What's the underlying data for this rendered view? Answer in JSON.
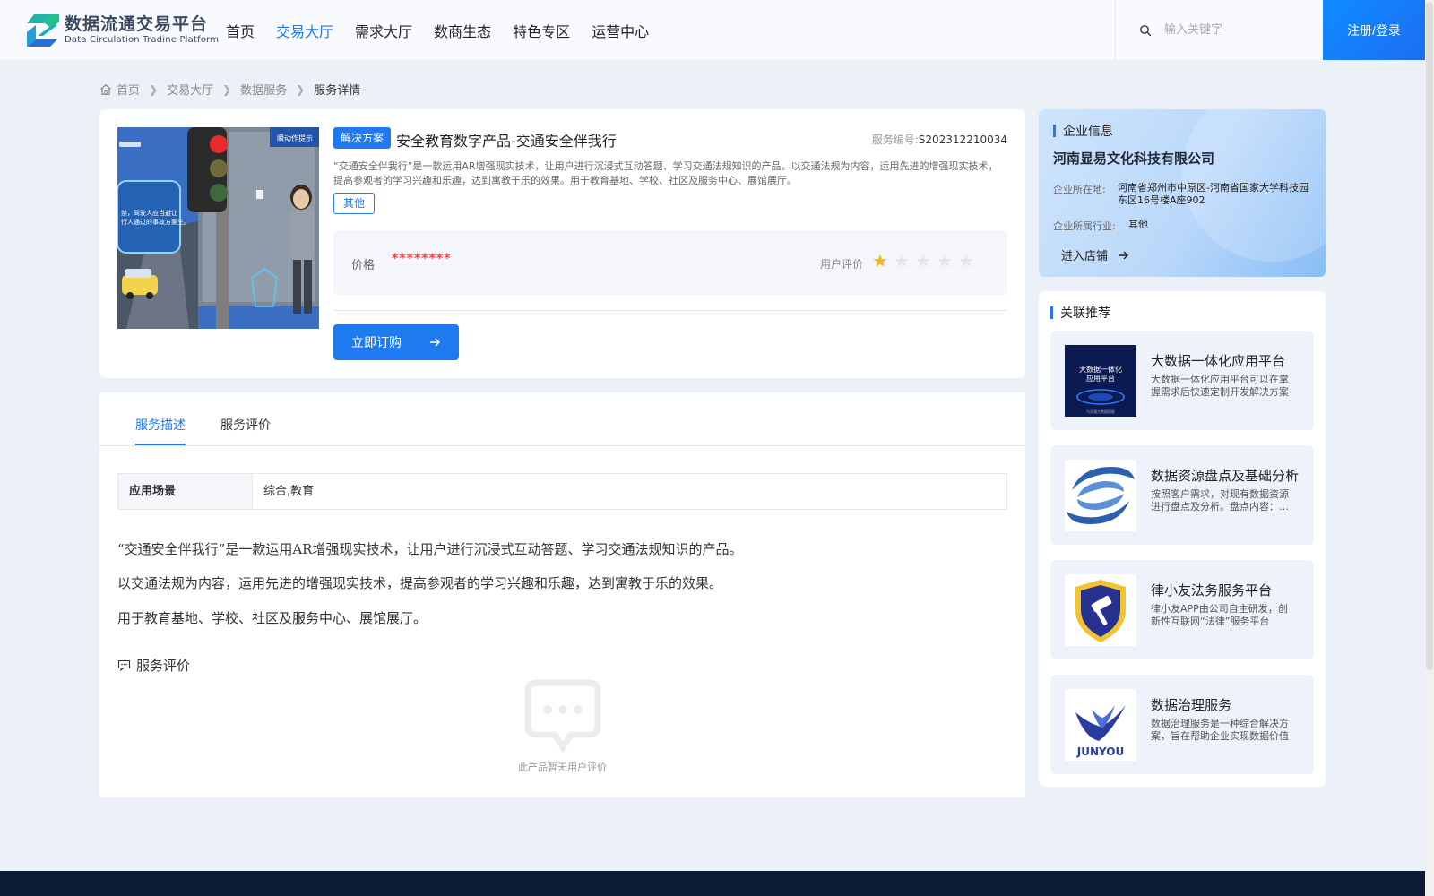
{
  "header": {
    "logo_cn": "数据流通交易平台",
    "logo_en": "Data Circulation Tradine Platform",
    "nav": [
      {
        "label": "首页",
        "active": false
      },
      {
        "label": "交易大厅",
        "active": true
      },
      {
        "label": "需求大厅",
        "active": false
      },
      {
        "label": "数商生态",
        "active": false
      },
      {
        "label": "特色专区",
        "active": false
      },
      {
        "label": "运营中心",
        "active": false
      }
    ],
    "search_placeholder": "输入关键字",
    "login_label": "注册/登录"
  },
  "breadcrumb": [
    "首页",
    "交易大厅",
    "数据服务",
    "服务详情"
  ],
  "product": {
    "tag": "解决方案",
    "title": "安全教育数字产品-交通安全伴我行",
    "service_no_label": "服务编号:",
    "service_no": "S202312210034",
    "description": "“交通安全伴我行”是一款运用AR增强现实技术，让用户进行沉浸式互动答题、学习交通法规知识的产品。以交通法规为内容，运用先进的增强现实技术，提高参观者的学习兴趣和乐趣，达到寓教于乐的效果。用于教育基地、学校、社区及服务中心、展馆展厅。",
    "category_tag": "其他",
    "price_label": "价格",
    "price_value": "********",
    "rating_label": "用户评价",
    "rating": 1,
    "rating_max": 5,
    "order_label": "立即订购",
    "image_text_1": "瞬动作提示",
    "image_text_2": "禁，驾驶人应当避让",
    "image_text_3": "行人通过的事故方案生。"
  },
  "tabs": [
    {
      "label": "服务描述",
      "active": true
    },
    {
      "label": "服务评价",
      "active": false
    }
  ],
  "scene": {
    "label": "应用场景",
    "value": "综合,教育"
  },
  "detail_paragraphs": [
    "“交通安全伴我行”是一款运用AR增强现实技术，让用户进行沉浸式互动答题、学习交通法规知识的产品。",
    "以交通法规为内容，运用先进的增强现实技术，提高参观者的学习兴趣和乐趣，达到寓教于乐的效果。",
    "用于教育基地、学校、社区及服务中心、展馆展厅。"
  ],
  "reviews": {
    "title": "服务评价",
    "empty_text": "此产品暂无用户评价"
  },
  "enterprise": {
    "section_title": "企业信息",
    "name": "河南显易文化科技有限公司",
    "location_label": "企业所在地:",
    "location": "河南省郑州市中原区-河南省国家大学科技园东区16号楼A座902",
    "industry_label": "企业所属行业:",
    "industry": "其他",
    "shop_label": "进入店铺"
  },
  "recommend": {
    "section_title": "关联推荐",
    "items": [
      {
        "title": "大数据一体化应用平台",
        "desc": "大数据一体化应用平台可以在掌握需求后快速定制开发解决方案",
        "img_text_1": "大数据一体化",
        "img_text_2": "应用平台",
        "img_text_3": "为交通大数据赋能"
      },
      {
        "title": "数据资源盘点及基础分析",
        "desc": "按照客户需求，对现有数据资源进行盘点及分析。盘点内容：数据资源",
        "img_text_1": "",
        "img_text_2": "",
        "img_text_3": ""
      },
      {
        "title": "律小友法务服务平台",
        "desc": "律小友APP由公司自主研发，创新性互联网“法律”服务平台",
        "img_text_1": "",
        "img_text_2": "",
        "img_text_3": ""
      },
      {
        "title": "数据治理服务",
        "desc": "数据治理服务是一种综合解决方案，旨在帮助企业实现数据价值",
        "img_text_1": "JUNYOU",
        "img_text_2": "",
        "img_text_3": ""
      }
    ]
  },
  "colors": {
    "primary": "#1f7af0",
    "price": "#f04545",
    "star_on": "#f5b623",
    "star_off": "#e5e5e5",
    "footer": "#0d1a35"
  }
}
